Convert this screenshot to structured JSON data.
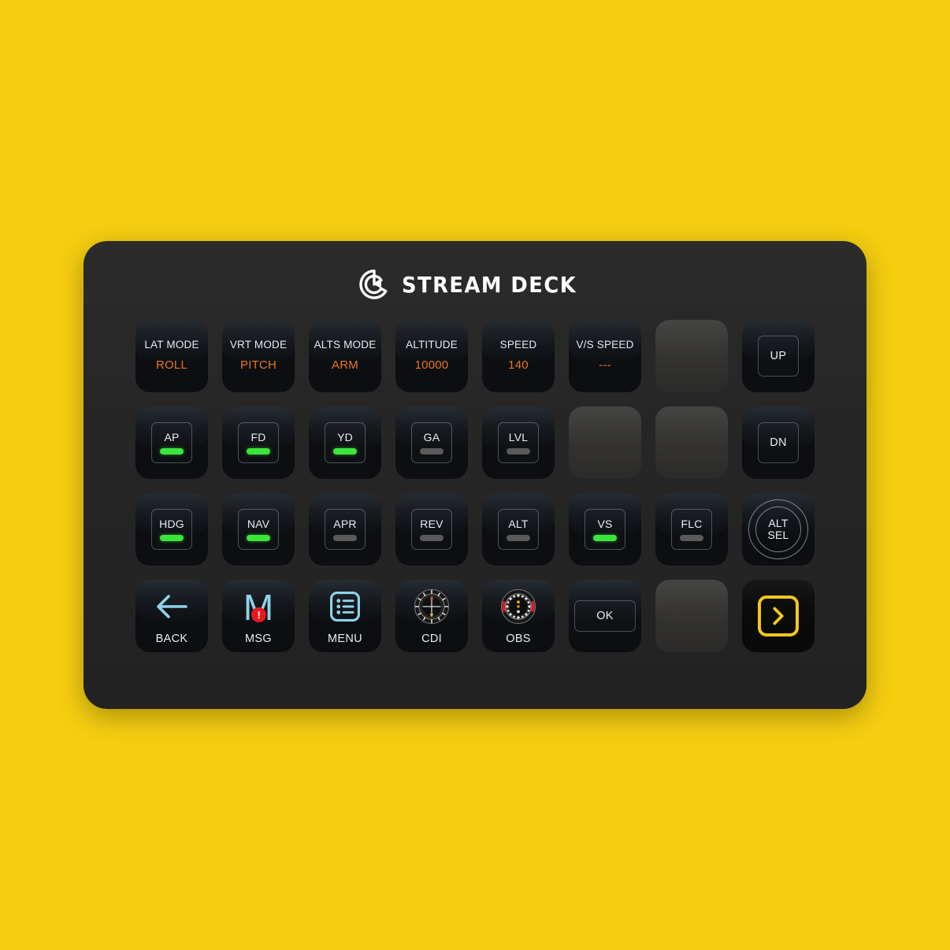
{
  "device": {
    "brand": "STREAM DECK",
    "logo_icon": "elgato-logo-icon",
    "background_color": "#f5ce10",
    "panel_color": "#262626",
    "accent_orange": "#e8761e",
    "accent_green": "#3ce53c",
    "accent_yellow": "#f6c51e",
    "icon_blue": "#8ed3ea",
    "badge_red": "#e8191e"
  },
  "grid": {
    "columns": 8,
    "rows": 4
  },
  "keys": [
    {
      "id": "lat-mode",
      "type": "status",
      "label": "LAT MODE",
      "value": "ROLL"
    },
    {
      "id": "vrt-mode",
      "type": "status",
      "label": "VRT MODE",
      "value": "PITCH"
    },
    {
      "id": "alts-mode",
      "type": "status",
      "label": "ALTS MODE",
      "value": "ARM"
    },
    {
      "id": "altitude",
      "type": "status",
      "label": "ALTITUDE",
      "value": "10000"
    },
    {
      "id": "speed",
      "type": "status",
      "label": "SPEED",
      "value": "140"
    },
    {
      "id": "vs-speed",
      "type": "status",
      "label": "V/S SPEED",
      "value": "---"
    },
    {
      "id": "empty-r1c7",
      "type": "empty",
      "label": ""
    },
    {
      "id": "up",
      "type": "box",
      "label": "UP"
    },
    {
      "id": "ap",
      "type": "annunciator",
      "label": "AP",
      "state": "on"
    },
    {
      "id": "fd",
      "type": "annunciator",
      "label": "FD",
      "state": "on"
    },
    {
      "id": "yd",
      "type": "annunciator",
      "label": "YD",
      "state": "on"
    },
    {
      "id": "ga",
      "type": "annunciator",
      "label": "GA",
      "state": "off"
    },
    {
      "id": "lvl",
      "type": "annunciator",
      "label": "LVL",
      "state": "off"
    },
    {
      "id": "empty-r2c6",
      "type": "empty",
      "label": ""
    },
    {
      "id": "empty-r2c7",
      "type": "empty",
      "label": ""
    },
    {
      "id": "dn",
      "type": "box",
      "label": "DN"
    },
    {
      "id": "hdg",
      "type": "annunciator",
      "label": "HDG",
      "state": "on"
    },
    {
      "id": "nav",
      "type": "annunciator",
      "label": "NAV",
      "state": "on"
    },
    {
      "id": "apr",
      "type": "annunciator",
      "label": "APR",
      "state": "off"
    },
    {
      "id": "rev",
      "type": "annunciator",
      "label": "REV",
      "state": "off"
    },
    {
      "id": "alt",
      "type": "annunciator",
      "label": "ALT",
      "state": "off"
    },
    {
      "id": "vs",
      "type": "annunciator",
      "label": "VS",
      "state": "on"
    },
    {
      "id": "flc",
      "type": "annunciator",
      "label": "FLC",
      "state": "off"
    },
    {
      "id": "alt-sel",
      "type": "ring",
      "label_line1": "ALT",
      "label_line2": "SEL"
    },
    {
      "id": "back",
      "type": "icon",
      "label": "BACK",
      "icon": "arrow-left-icon"
    },
    {
      "id": "msg",
      "type": "icon",
      "label": "MSG",
      "icon": "message-alert-icon",
      "glyph": "M",
      "badge": "!"
    },
    {
      "id": "menu",
      "type": "icon",
      "label": "MENU",
      "icon": "list-menu-icon"
    },
    {
      "id": "cdi",
      "type": "icon",
      "label": "CDI",
      "icon": "cdi-compass-icon"
    },
    {
      "id": "obs",
      "type": "icon",
      "label": "OBS",
      "icon": "obs-compass-icon"
    },
    {
      "id": "ok",
      "type": "wide-box",
      "label": "OK"
    },
    {
      "id": "empty-r4c7",
      "type": "empty",
      "label": ""
    },
    {
      "id": "next",
      "type": "chevron",
      "label": "",
      "icon": "chevron-right-icon"
    }
  ]
}
